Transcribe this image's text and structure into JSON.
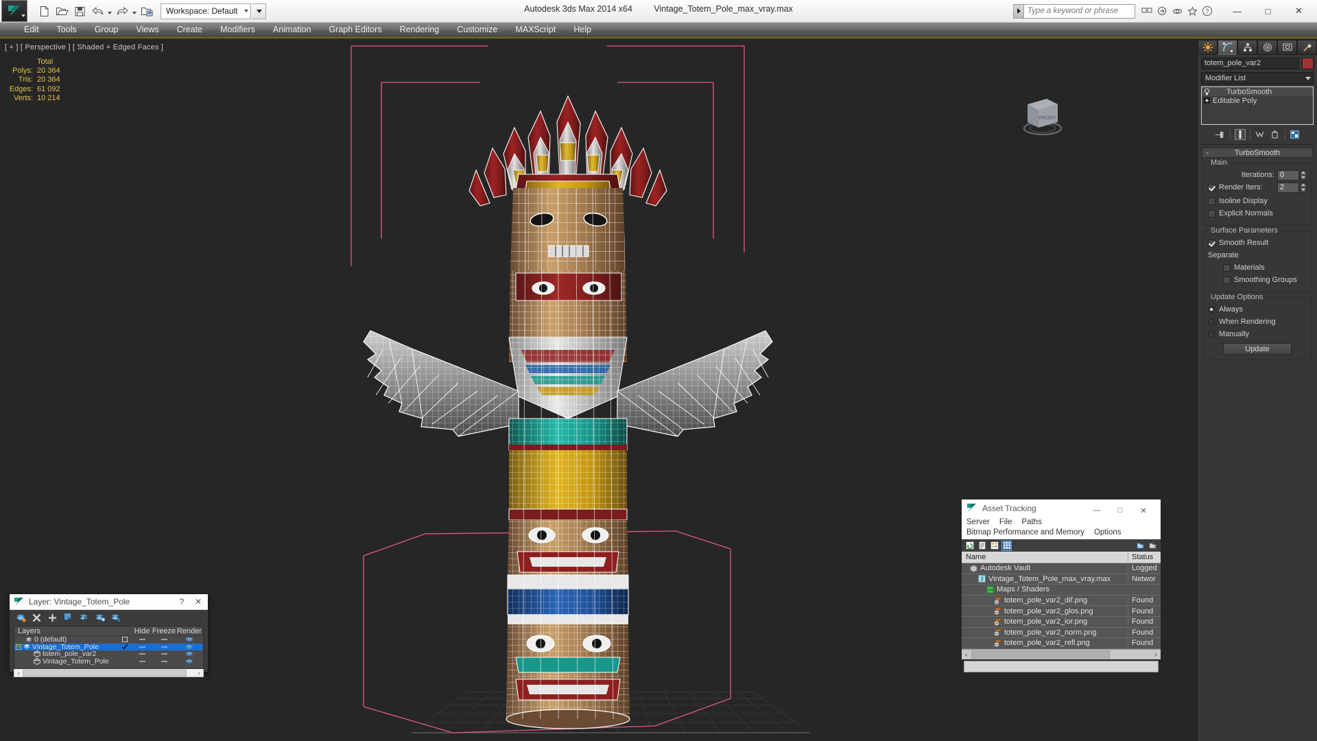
{
  "app": {
    "title_app": "Autodesk 3ds Max  2014 x64",
    "title_file": "Vintage_Totem_Pole_max_vray.max",
    "workspace": "Workspace: Default",
    "search_placeholder": "Type a keyword or phrase",
    "window_buttons": {
      "minimize": "—",
      "maximize": "□",
      "close": "✕"
    }
  },
  "quick_access": [
    {
      "name": "new-file-icon",
      "label": "New"
    },
    {
      "name": "open-file-icon",
      "label": "Open"
    },
    {
      "name": "save-file-icon",
      "label": "Save"
    },
    {
      "name": "undo-icon",
      "label": "Undo"
    },
    {
      "name": "redo-icon",
      "label": "Redo"
    },
    {
      "name": "project-folder-icon",
      "label": "Set Project Folder"
    }
  ],
  "menu": [
    "Edit",
    "Tools",
    "Group",
    "Views",
    "Create",
    "Modifiers",
    "Animation",
    "Graph Editors",
    "Rendering",
    "Customize",
    "MAXScript",
    "Help"
  ],
  "viewport": {
    "label": "[ + ] [ Perspective ] [ Shaded + Edged Faces ]",
    "viewcube_face": "FRONT",
    "stats": {
      "header": "Total",
      "rows": [
        {
          "label": "Polys:",
          "value": "20 364"
        },
        {
          "label": "Tris:",
          "value": "20 364"
        },
        {
          "label": "Edges:",
          "value": "61 092"
        },
        {
          "label": "Verts:",
          "value": "10 214"
        }
      ]
    }
  },
  "command_panel": {
    "tabs": [
      {
        "name": "create-tab",
        "icon": "star-icon",
        "active": false
      },
      {
        "name": "modify-tab",
        "icon": "curve-icon",
        "active": true
      },
      {
        "name": "hierarchy-tab",
        "icon": "hierarchy-icon",
        "active": false
      },
      {
        "name": "motion-tab",
        "icon": "motion-icon",
        "active": false
      },
      {
        "name": "display-tab",
        "icon": "display-icon",
        "active": false
      },
      {
        "name": "utilities-tab",
        "icon": "hammer-icon",
        "active": false
      }
    ],
    "object_name": "totem_pole_var2",
    "object_color": "#a33232",
    "modifier_list_label": "Modifier List",
    "stack": [
      {
        "label": "TurboSmooth",
        "selected": true
      },
      {
        "label": "Editable Poly",
        "selected": false
      }
    ],
    "rollout": {
      "title": "TurboSmooth",
      "collapse_sign": "-",
      "main": {
        "group_label": "Main",
        "iterations_label": "Iterations:",
        "iterations_value": "0",
        "render_iters_label": "Render Iters:",
        "render_iters_value": "2",
        "render_iters_checked": true,
        "isoline_display_label": "Isoline Display",
        "isoline_display_checked": false,
        "explicit_normals_label": "Explicit Normals",
        "explicit_normals_checked": false
      },
      "surface": {
        "group_label": "Surface Parameters",
        "smooth_result_label": "Smooth Result",
        "smooth_result_checked": true,
        "separate_label": "Separate",
        "materials_label": "Materials",
        "materials_checked": false,
        "smoothing_groups_label": "Smoothing Groups",
        "smoothing_groups_checked": false
      },
      "update": {
        "group_label": "Update Options",
        "options": [
          {
            "label": "Always",
            "selected": true
          },
          {
            "label": "When Rendering",
            "selected": false
          },
          {
            "label": "Manually",
            "selected": false
          }
        ],
        "button_label": "Update"
      }
    }
  },
  "layer_dialog": {
    "title": "Layer: Vintage_Totem_Pole",
    "help_label": "?",
    "close_label": "✕",
    "toolbar": [
      {
        "name": "new-layer-icon"
      },
      {
        "name": "delete-layer-icon"
      },
      {
        "name": "add-layer-icon"
      },
      {
        "name": "select-objects-in-layer-icon"
      },
      {
        "name": "highlight-selected-objects-icon"
      },
      {
        "name": "add-selection-to-layer-icon"
      },
      {
        "name": "layer-settings-icon"
      }
    ],
    "columns": [
      "Layers",
      "",
      "Hide",
      "Freeze",
      "Render"
    ],
    "rows": [
      {
        "name": "0 (default)",
        "indent": 1,
        "icon": "layer-icon",
        "selected": false,
        "current": false,
        "box": true
      },
      {
        "name": "Vintage_Totem_Pole",
        "indent": 0,
        "icon": "layer-icon",
        "selected": true,
        "current": true,
        "expander": "−"
      },
      {
        "name": "totem_pole_var2",
        "indent": 2,
        "icon": "object-icon",
        "selected": false,
        "current": false
      },
      {
        "name": "Vintage_Totem_Pole",
        "indent": 2,
        "icon": "object-icon",
        "selected": false,
        "current": false
      }
    ],
    "scroll_left": "‹",
    "scroll_right": "›"
  },
  "asset_tracking": {
    "title": "Asset Tracking",
    "window_buttons": {
      "minimize": "—",
      "maximize": "□",
      "close": "✕"
    },
    "menus_row1": [
      "Server",
      "File",
      "Paths"
    ],
    "menus_row2": [
      "Bitmap Performance and Memory",
      "Options"
    ],
    "toolbar": [
      {
        "name": "refresh-icon",
        "selected": false
      },
      {
        "name": "list-view-icon",
        "selected": false
      },
      {
        "name": "detail-view-icon",
        "selected": false
      },
      {
        "name": "grid-view-icon",
        "selected": true
      }
    ],
    "toolbar_right": [
      {
        "name": "add-asset-help-icon"
      },
      {
        "name": "asset-help-icon"
      }
    ],
    "columns": [
      "Name",
      "Status"
    ],
    "rows": [
      {
        "name": "Autodesk Vault",
        "status": "Logged",
        "indent": 1,
        "icon": "vault-icon"
      },
      {
        "name": "Vintage_Totem_Pole_max_vray.max",
        "status": "Networ",
        "indent": 2,
        "icon": "max-file-icon"
      },
      {
        "name": "Maps / Shaders",
        "status": "",
        "indent": 3,
        "icon": "maps-icon"
      },
      {
        "name": "totem_pole_var2_dif.png",
        "status": "Found",
        "indent": 4,
        "icon": "bitmap-icon"
      },
      {
        "name": "totem_pole_var2_glos.png",
        "status": "Found",
        "indent": 4,
        "icon": "bitmap-icon"
      },
      {
        "name": "totem_pole_var2_ior.png",
        "status": "Found",
        "indent": 4,
        "icon": "bitmap-icon"
      },
      {
        "name": "totem_pole_var2_norm.png",
        "status": "Found",
        "indent": 4,
        "icon": "bitmap-icon"
      },
      {
        "name": "totem_pole_var2_refl.png",
        "status": "Found",
        "indent": 4,
        "icon": "bitmap-icon"
      }
    ],
    "scroll_left": "‹",
    "scroll_right": "›"
  },
  "colors": {
    "viewport_bg": "#262626",
    "stats_text": "#e0c04a",
    "accent_gold": "#7a6520",
    "selection_blue": "#1a6fd4",
    "wire_white": "#ffffff",
    "gizmo_pink": "#e2568f"
  }
}
